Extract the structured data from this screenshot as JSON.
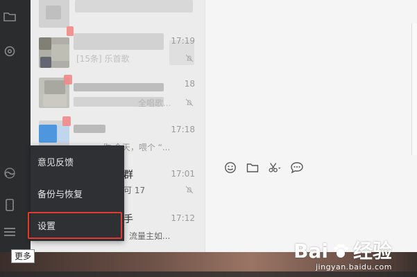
{
  "chat_list": {
    "items": [
      {
        "time": "",
        "preview": ""
      },
      {
        "time": "17:19",
        "preview": "[15条] 乐首歌"
      },
      {
        "time": "18",
        "preview": "全唱歌..."
      },
      {
        "time": "17:18",
        "preview": "你 今天，喂个 “..."
      },
      {
        "time": "17:01",
        "title_tail": "群",
        "preview": "可 17"
      },
      {
        "time": "17:12",
        "title_tail": "手",
        "preview": "流量主如..."
      }
    ]
  },
  "menu": {
    "items": [
      {
        "label": "意见反馈"
      },
      {
        "label": "备份与恢复"
      },
      {
        "label": "设置"
      }
    ]
  },
  "tooltip": {
    "label": "更多"
  },
  "watermark": {
    "title_left": "Bai",
    "title_right": "经验",
    "subtitle": "jingyan.baidu.com"
  },
  "colors": {
    "sidebar": "#2b2c2e",
    "menu_bg": "#2f3033",
    "highlight": "#e33a2f"
  },
  "icons": {
    "sidebar": [
      "folder-icon",
      "plugin-icon",
      "mini-program-icon",
      "phone-icon",
      "menu-icon"
    ],
    "toolbar": [
      "emoji-icon",
      "folder-icon",
      "screenshot-icon",
      "chat-bubble-icon"
    ]
  }
}
